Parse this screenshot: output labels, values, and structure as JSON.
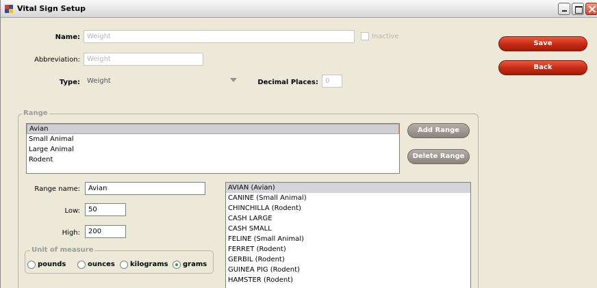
{
  "window": {
    "title": "Vital Sign Setup"
  },
  "form": {
    "name_label": "Name:",
    "name_value": "Weight",
    "inactive_label": "Inactive",
    "abbreviation_label": "Abbreviation:",
    "abbreviation_value": "Weight",
    "type_label": "Type:",
    "type_value": "Weight",
    "decimal_label": "Decimal Places:",
    "decimal_value": "0"
  },
  "actions": {
    "save_label": "Save",
    "back_label": "Back"
  },
  "range": {
    "legend": "Range",
    "items": [
      "Avian",
      "Small Animal",
      "Large Animal",
      "Rodent"
    ],
    "add_label": "Add Range",
    "delete_label": "Delete Range",
    "name_label": "Range name:",
    "name_value": "Avian",
    "low_label": "Low:",
    "low_value": "50",
    "high_label": "High:",
    "high_value": "200",
    "unit_legend": "Unit of measure",
    "units": [
      "pounds",
      "ounces",
      "kilograms",
      "grams"
    ],
    "selected_unit": "grams",
    "species": [
      "AVIAN (Avian)",
      "CANINE (Small Animal)",
      "CHINCHILLA (Rodent)",
      "CASH LARGE",
      "CASH SMALL",
      "FELINE (Small Animal)",
      "FERRET (Rodent)",
      "GERBIL (Rodent)",
      "GUINEA PIG (Rodent)",
      "HAMSTER (Rodent)"
    ]
  },
  "colors": {
    "accent_red": "#C52A13",
    "window_bg": "#ECE9D8"
  }
}
